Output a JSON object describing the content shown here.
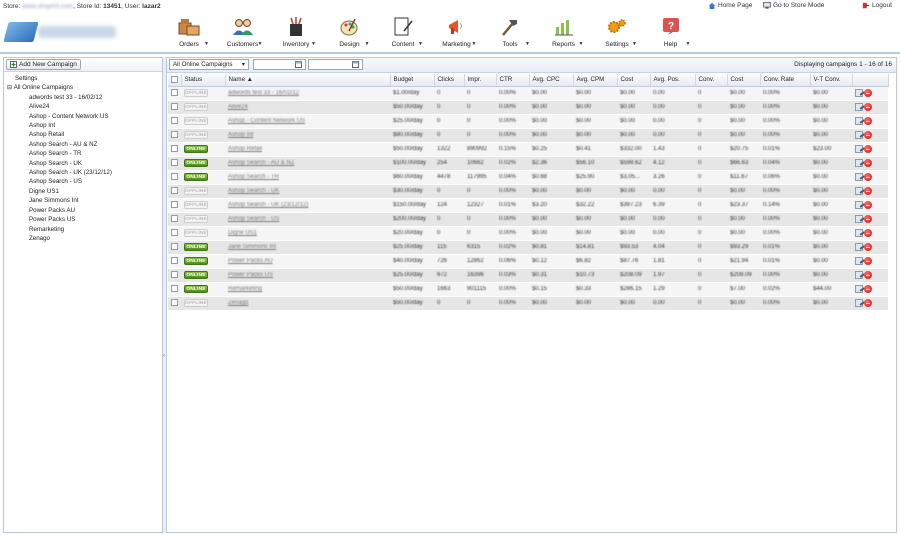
{
  "topbar": {
    "store_prefix": "Store:",
    "store_name": "www.shop03.com",
    "store_id_label": ", Store Id:",
    "store_id": "13451",
    "user_label": ", User:",
    "user": "lazar2",
    "home_page": "Home Page",
    "store_mode": "Go to Store Mode",
    "logout": "Logout"
  },
  "nav": [
    {
      "label": "Orders",
      "icon": "orders-icon"
    },
    {
      "label": "Customers",
      "icon": "customers-icon"
    },
    {
      "label": "Inventory",
      "icon": "inventory-icon"
    },
    {
      "label": "Design",
      "icon": "design-icon"
    },
    {
      "label": "Content",
      "icon": "content-icon"
    },
    {
      "label": "Marketing",
      "icon": "marketing-icon"
    },
    {
      "label": "Tools",
      "icon": "tools-icon"
    },
    {
      "label": "Reports",
      "icon": "reports-icon"
    },
    {
      "label": "Settings",
      "icon": "settings-icon"
    },
    {
      "label": "Help",
      "icon": "help-icon"
    }
  ],
  "sidebar": {
    "add_button": "Add New Campaign",
    "settings": "Settings",
    "root": "All Online Campaigns",
    "items": [
      "adwords test 33 - 16/02/12",
      "Alive24",
      "Ashop - Content Network US",
      "Ashop Int",
      "Ashop Retail",
      "Ashop Search - AU & NZ",
      "Ashop Search - TR",
      "Ashop Search - UK",
      "Ashop Search - UK (23/12/12)",
      "Ashop Search - US",
      "Digne US1",
      "Jane Simmons Int",
      "Power Packs AU",
      "Power Packs US",
      "Remarketing",
      "Zenago"
    ]
  },
  "toolbar": {
    "filter_value": "All Online Campaigns",
    "date_from": "",
    "date_to": "",
    "display_text": "Displaying campaigns 1 - 16 of 16"
  },
  "table": {
    "headers": [
      "",
      "Status",
      "Name ▲",
      "Budget",
      "Clicks",
      "Impr.",
      "CTR",
      "Avg. CPC",
      "Avg. CPM",
      "Cost",
      "Avg. Pos.",
      "Conv.",
      "Cost",
      "Conv. Rate",
      "V-T Conv.",
      ""
    ],
    "rows": [
      {
        "status": "OFFLINE",
        "name": "adwords test 33 - 16/02/12",
        "budget": "$1.00/day",
        "clicks": "0",
        "impr": "0",
        "ctr": "0.00%",
        "cpc": "$0.00",
        "cpm": "$0.00",
        "cost": "$0.00",
        "pos": "0.00",
        "conv": "0",
        "cost2": "$0.00",
        "rate": "0.00%",
        "vt": "$0.00"
      },
      {
        "status": "OFFLINE",
        "name": "Alive24",
        "budget": "$50.00/day",
        "clicks": "0",
        "impr": "0",
        "ctr": "0.00%",
        "cpc": "$0.00",
        "cpm": "$0.00",
        "cost": "$0.00",
        "pos": "0.00",
        "conv": "0",
        "cost2": "$0.00",
        "rate": "0.00%",
        "vt": "$0.00"
      },
      {
        "status": "OFFLINE",
        "name": "Ashop - Content Network US",
        "budget": "$25.00/day",
        "clicks": "0",
        "impr": "0",
        "ctr": "0.00%",
        "cpc": "$0.00",
        "cpm": "$0.00",
        "cost": "$0.00",
        "pos": "0.00",
        "conv": "0",
        "cost2": "$0.00",
        "rate": "0.00%",
        "vt": "$0.00"
      },
      {
        "status": "OFFLINE",
        "name": "Ashop Int",
        "budget": "$80.00/day",
        "clicks": "0",
        "impr": "0",
        "ctr": "0.00%",
        "cpc": "$0.00",
        "cpm": "$0.00",
        "cost": "$0.00",
        "pos": "0.00",
        "conv": "0",
        "cost2": "$0.00",
        "rate": "0.00%",
        "vt": "$0.00"
      },
      {
        "status": "ONLINE",
        "name": "Ashop Retail",
        "budget": "$50.00/day",
        "clicks": "1322",
        "impr": "890992",
        "ctr": "0.15%",
        "cpc": "$0.25",
        "cpm": "$0.41",
        "cost": "$332.00",
        "pos": "1.43",
        "conv": "0",
        "cost2": "$20.75",
        "rate": "0.01%",
        "vt": "$23.00"
      },
      {
        "status": "ONLINE",
        "name": "Ashop Search - AU & NZ",
        "budget": "$100.00/day",
        "clicks": "254",
        "impr": "10662",
        "ctr": "0.02%",
        "cpc": "$2.36",
        "cpm": "$56.10",
        "cost": "$598.62",
        "pos": "4.12",
        "conv": "0",
        "cost2": "$66.63",
        "rate": "0.04%",
        "vt": "$0.00"
      },
      {
        "status": "ONLINE",
        "name": "Ashop Search - TR",
        "budget": "$60.00/day",
        "clicks": "4478",
        "impr": "117995",
        "ctr": "0.04%",
        "cpc": "$0.68",
        "cpm": "$25.90",
        "cost": "$3,05...",
        "pos": "3.26",
        "conv": "0",
        "cost2": "$11.67",
        "rate": "0.06%",
        "vt": "$0.00"
      },
      {
        "status": "OFFLINE",
        "name": "Ashop Search - UK",
        "budget": "$30.00/day",
        "clicks": "0",
        "impr": "0",
        "ctr": "0.00%",
        "cpc": "$0.00",
        "cpm": "$0.00",
        "cost": "$0.00",
        "pos": "0.00",
        "conv": "0",
        "cost2": "$0.00",
        "rate": "0.00%",
        "vt": "$0.00"
      },
      {
        "status": "OFFLINE",
        "name": "Ashop Search - UK (23/12/12)",
        "budget": "$150.00/day",
        "clicks": "124",
        "impr": "12327",
        "ctr": "0.01%",
        "cpc": "$3.20",
        "cpm": "$32.22",
        "cost": "$397.23",
        "pos": "6.39",
        "conv": "0",
        "cost2": "$23.37",
        "rate": "0.14%",
        "vt": "$0.00"
      },
      {
        "status": "OFFLINE",
        "name": "Ashop Search - US",
        "budget": "$200.00/day",
        "clicks": "0",
        "impr": "0",
        "ctr": "0.00%",
        "cpc": "$0.00",
        "cpm": "$0.00",
        "cost": "$0.00",
        "pos": "0.00",
        "conv": "0",
        "cost2": "$0.00",
        "rate": "0.00%",
        "vt": "$0.00"
      },
      {
        "status": "OFFLINE",
        "name": "Digne US1",
        "budget": "$20.00/day",
        "clicks": "0",
        "impr": "0",
        "ctr": "0.00%",
        "cpc": "$0.00",
        "cpm": "$0.00",
        "cost": "$0.00",
        "pos": "0.00",
        "conv": "0",
        "cost2": "$0.00",
        "rate": "0.00%",
        "vt": "$0.00"
      },
      {
        "status": "ONLINE",
        "name": "Jane Simmons Int",
        "budget": "$25.00/day",
        "clicks": "115",
        "impr": "6315",
        "ctr": "0.02%",
        "cpc": "$0.81",
        "cpm": "$14.81",
        "cost": "$93.53",
        "pos": "4.04",
        "conv": "0",
        "cost2": "$93.29",
        "rate": "0.01%",
        "vt": "$0.00"
      },
      {
        "status": "ONLINE",
        "name": "Power Packs AU",
        "budget": "$40.00/day",
        "clicks": "726",
        "impr": "12862",
        "ctr": "0.06%",
        "cpc": "$0.12",
        "cpm": "$6.82",
        "cost": "$87.76",
        "pos": "1.81",
        "conv": "0",
        "cost2": "$21.94",
        "rate": "0.01%",
        "vt": "$0.00"
      },
      {
        "status": "ONLINE",
        "name": "Power Packs US",
        "budget": "$25.00/day",
        "clicks": "672",
        "impr": "16396",
        "ctr": "0.03%",
        "cpc": "$0.31",
        "cpm": "$10.73",
        "cost": "$208.09",
        "pos": "1.97",
        "conv": "0",
        "cost2": "$208.09",
        "rate": "0.00%",
        "vt": "$0.00"
      },
      {
        "status": "ONLINE",
        "name": "Remarketing",
        "budget": "$50.00/day",
        "clicks": "1663",
        "impr": "901115",
        "ctr": "0.00%",
        "cpc": "$0.15",
        "cpm": "$0.33",
        "cost": "$286.15",
        "pos": "1.29",
        "conv": "0",
        "cost2": "$7.00",
        "rate": "0.02%",
        "vt": "$44.00"
      },
      {
        "status": "OFFLINE",
        "name": "Zenago",
        "budget": "$50.00/day",
        "clicks": "0",
        "impr": "0",
        "ctr": "0.00%",
        "cpc": "$0.00",
        "cpm": "$0.00",
        "cost": "$0.00",
        "pos": "0.00",
        "conv": "0",
        "cost2": "$0.00",
        "rate": "0.00%",
        "vt": "$0.00"
      }
    ]
  }
}
